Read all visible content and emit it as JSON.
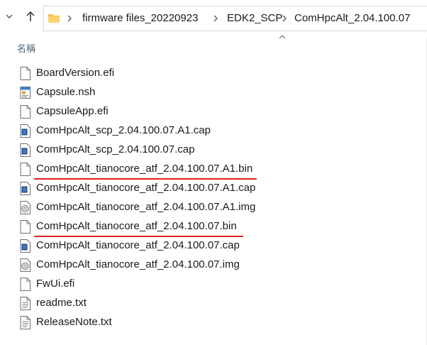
{
  "breadcrumb": {
    "items": [
      "firmware files_20220923",
      "EDK2_SCP",
      "ComHpcAlt_2.04.100.07"
    ]
  },
  "column_header": {
    "name_label": "名稱"
  },
  "files": [
    {
      "name": "BoardVersion.efi",
      "icon": "generic-file-icon"
    },
    {
      "name": "Capsule.nsh",
      "icon": "script-file-icon"
    },
    {
      "name": "CapsuleApp.efi",
      "icon": "generic-file-icon"
    },
    {
      "name": "ComHpcAlt_scp_2.04.100.07.A1.cap",
      "icon": "cap-file-icon"
    },
    {
      "name": "ComHpcAlt_scp_2.04.100.07.cap",
      "icon": "cap-file-icon"
    },
    {
      "name": "ComHpcAlt_tianocore_atf_2.04.100.07.A1.bin",
      "icon": "generic-file-icon",
      "underlined": true
    },
    {
      "name": "ComHpcAlt_tianocore_atf_2.04.100.07.A1.cap",
      "icon": "cap-file-icon"
    },
    {
      "name": "ComHpcAlt_tianocore_atf_2.04.100.07.A1.img",
      "icon": "disc-image-icon"
    },
    {
      "name": "ComHpcAlt_tianocore_atf_2.04.100.07.bin",
      "icon": "generic-file-icon",
      "underlined": true
    },
    {
      "name": "ComHpcAlt_tianocore_atf_2.04.100.07.cap",
      "icon": "cap-file-icon"
    },
    {
      "name": "ComHpcAlt_tianocore_atf_2.04.100.07.img",
      "icon": "disc-image-icon"
    },
    {
      "name": "FwUi.efi",
      "icon": "generic-file-icon"
    },
    {
      "name": "readme.txt",
      "icon": "text-file-icon"
    },
    {
      "name": "ReleaseNote.txt",
      "icon": "text-file-icon"
    }
  ],
  "colors": {
    "annotation_underline": "#e0201b",
    "folder_yellow": "#f5c342",
    "header_text": "#4c607a"
  }
}
